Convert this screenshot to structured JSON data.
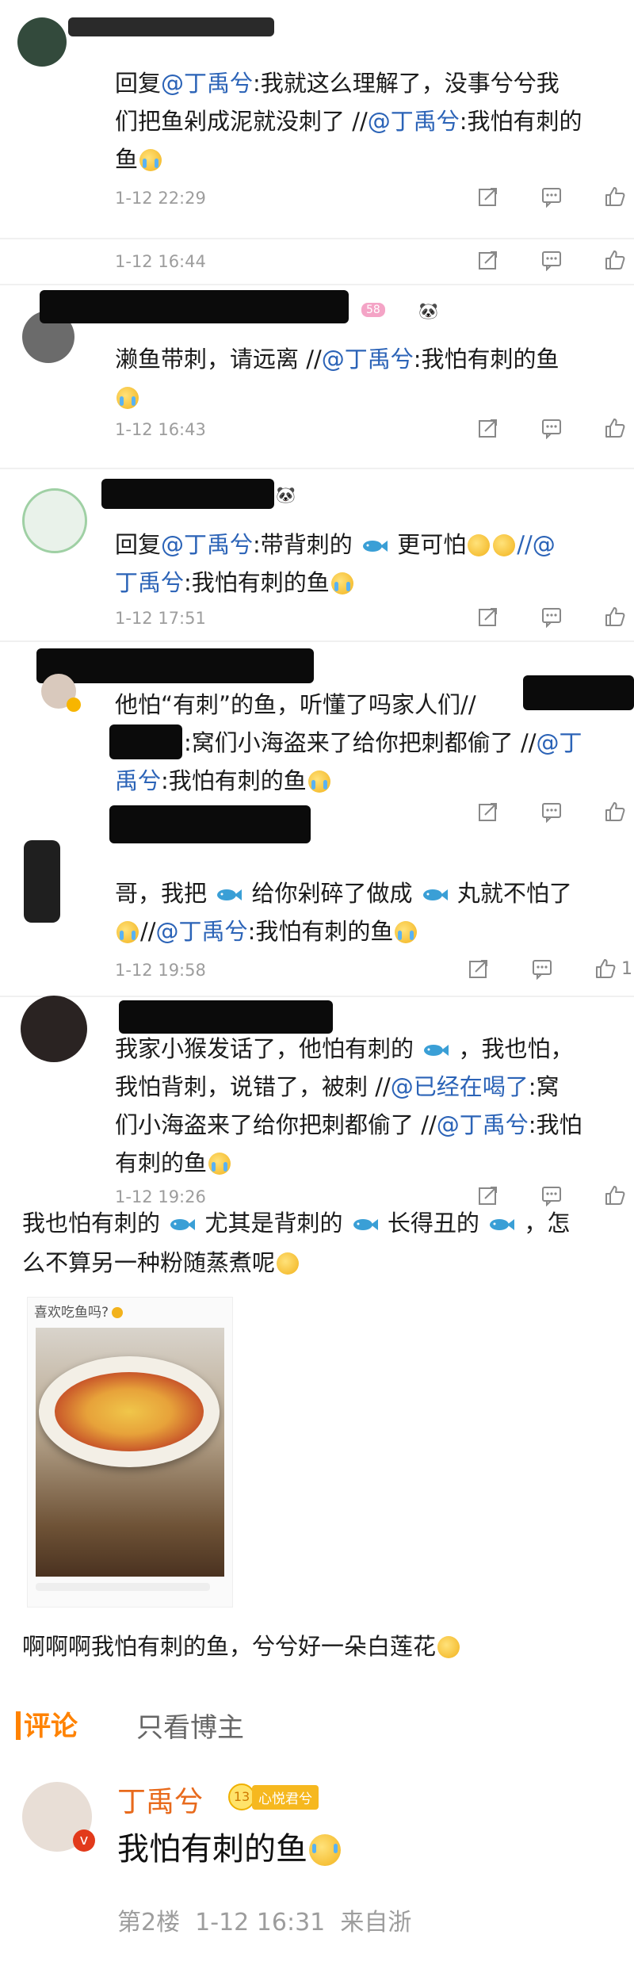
{
  "comments": [
    {
      "parts": [
        "回复",
        "@丁禹兮",
        ":我就这么理解了，没事兮兮我",
        "们把鱼剁成泥就没刺了 //",
        "@丁禹兮",
        ":我怕有刺的",
        "鱼"
      ],
      "time": "1-12 22:29"
    },
    {
      "time": "1-12 16:44"
    },
    {
      "line1": "濑鱼带刺，请远离 //",
      "mention": "@丁禹兮",
      "line1b": ":我怕有刺的鱼",
      "time": "1-12 16:43",
      "badge": "58"
    },
    {
      "line1a": "回复",
      "mention1": "@丁禹兮",
      "line1b": ":带背刺的",
      "line1c": "更可怕",
      "line1d": "//@",
      "line2a": "丁禹兮",
      "line2b": ":我怕有刺的鱼",
      "time": "1-12 17:51"
    },
    {
      "line1": "他怕“有刺”的鱼，听懂了吗家人们//",
      "line2": ":窝们小海盗来了给你把刺都偷了 //",
      "mention": "@丁",
      "line3a": "禹兮",
      "line3b": ":我怕有刺的鱼"
    },
    {
      "line1a": "哥，我把",
      "line1b": "给你剁碎了做成",
      "line1c": "丸就不怕了",
      "line2a": "//",
      "mention": "@丁禹兮",
      "line2b": ":我怕有刺的鱼",
      "time": "1-12 19:58",
      "likes": "1"
    },
    {
      "line1a": "我家小猴发话了，他怕有刺的",
      "line1b": "，我也怕，",
      "line2a": "我怕背刺，说错了，被刺 //",
      "mention1": "@已经在喝了",
      "line2b": ":窝",
      "line3a": "们小海盗来了给你把刺都偷了 //",
      "mention2": "@丁禹兮",
      "line3b": ":我怕",
      "line4": "有刺的鱼",
      "time": "1-12 19:26"
    }
  ],
  "post": {
    "line1a": "我也怕有刺的",
    "line1b": "尤其是背刺的",
    "line1c": "长得丑的",
    "line1d": "，怎",
    "line2": "么不算另一种粉随蒸煮呢",
    "image_caption": "喜欢吃鱼吗?",
    "after_text": "啊啊啊我怕有刺的鱼，兮兮好一朵白莲花"
  },
  "tabs": {
    "comments": "评论",
    "only_author": "只看博主"
  },
  "author_reply": {
    "name": "丁禹兮",
    "level": "13",
    "fan_badge": "心悦君兮",
    "text": "我怕有刺的鱼",
    "floor": "第2楼",
    "time": "1-12 16:31",
    "source": "来自浙"
  },
  "colors": {
    "link": "#2b63b7",
    "time": "#9d9d9d",
    "accent": "#ff8200"
  }
}
